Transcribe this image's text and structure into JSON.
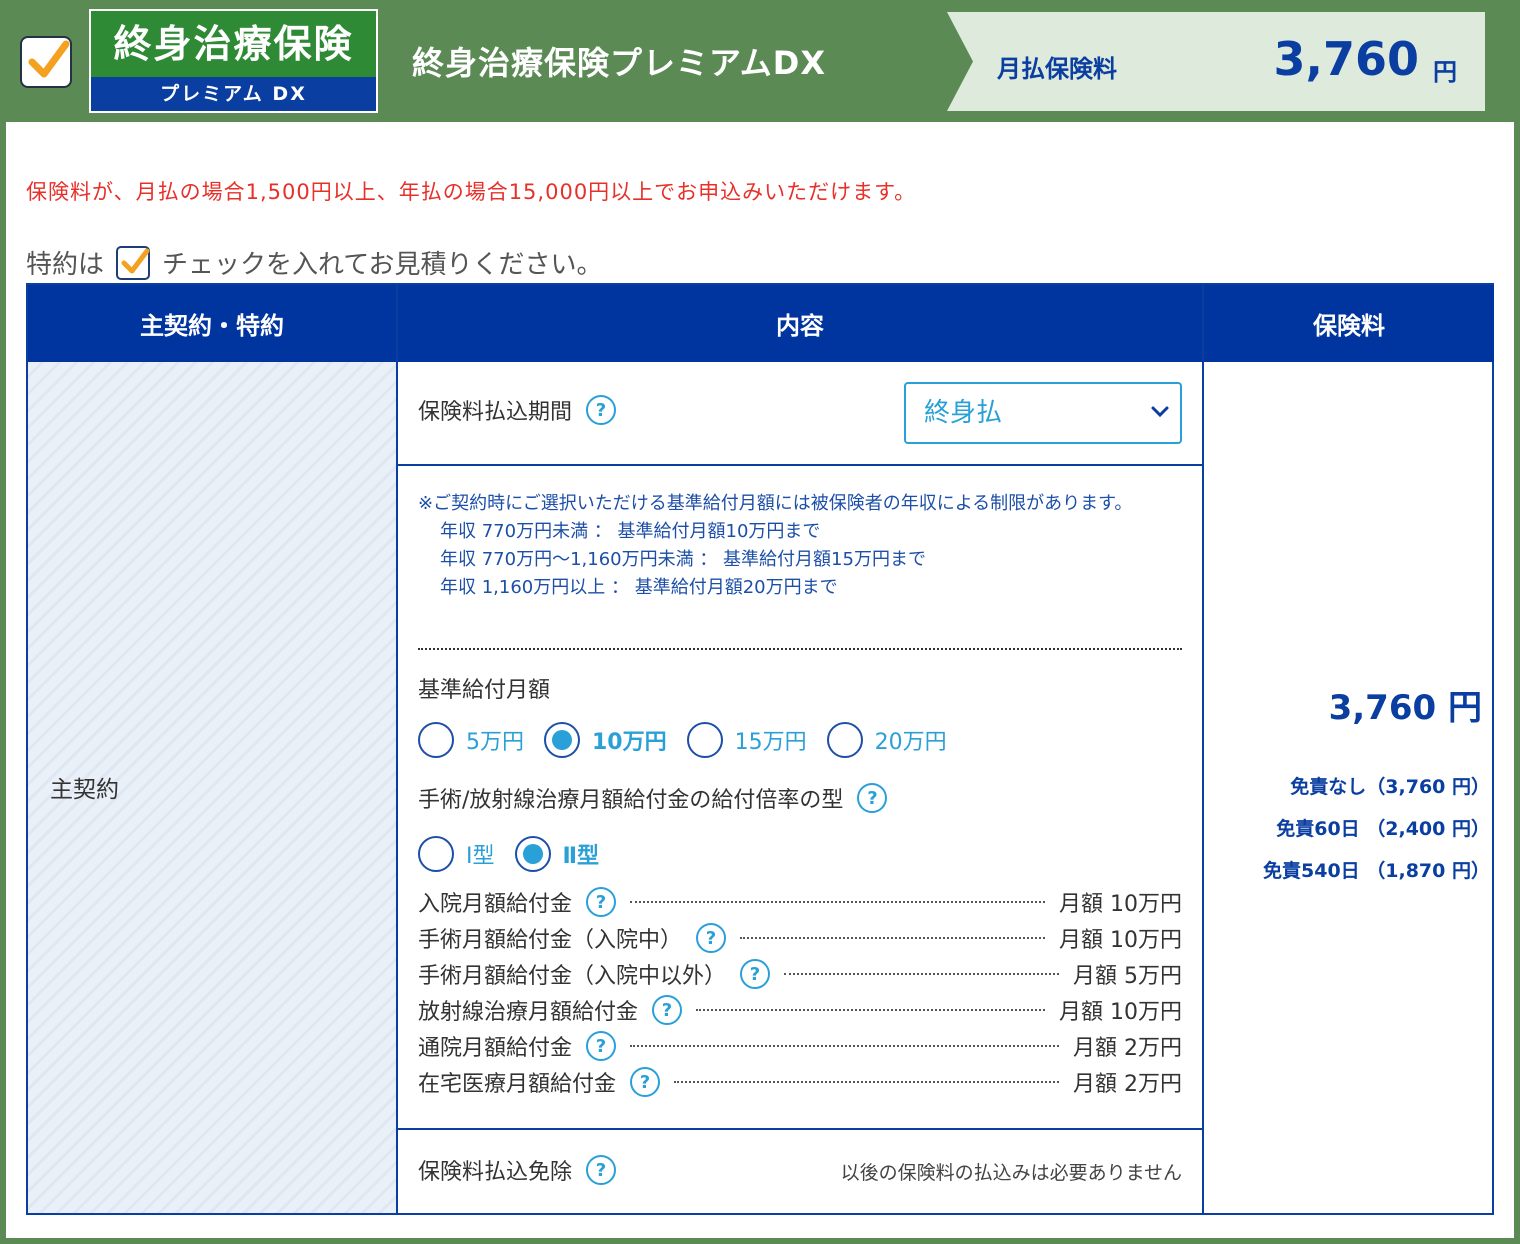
{
  "header": {
    "logo_top": "終身治療保険",
    "logo_bottom": "プレミアム DX",
    "title": "終身治療保険プレミアムDX",
    "premium_label": "月払保険料",
    "premium_value": "3,760",
    "premium_unit": "円"
  },
  "notice": "保険料が、月払の場合1,500円以上、年払の場合15,000円以上でお申込みいただけます。",
  "rider_note": {
    "before": "特約は",
    "after": "チェックを入れてお見積りください。"
  },
  "table": {
    "headers": [
      "主契約・特約",
      "内容",
      "保険料"
    ],
    "main_label": "主契約",
    "payment_period": {
      "label": "保険料払込期間",
      "selected": "終身払"
    },
    "info": {
      "line1": "※ご契約時にご選択いただける基準給付月額には被保険者の年収による制限があります。",
      "line2": "年収 770万円未満 ： 基準給付月額10万円まで",
      "line3": "年収 770万円～1,160万円未満 ： 基準給付月額15万円まで",
      "line4": "年収 1,160万円以上 ： 基準給付月額20万円まで"
    },
    "base_amount": {
      "label": "基準給付月額",
      "options": [
        "5万円",
        "10万円",
        "15万円",
        "20万円"
      ],
      "selected_index": 1
    },
    "multiplier": {
      "label": "手術/放射線治療月額給付金の給付倍率の型",
      "options": [
        "Ⅰ型",
        "Ⅱ型"
      ],
      "selected_index": 1
    },
    "benefits": [
      {
        "label": "入院月額給付金",
        "value": "月額 10万円"
      },
      {
        "label": "手術月額給付金（入院中）",
        "value": "月額 10万円"
      },
      {
        "label": "手術月額給付金（入院中以外）",
        "value": "月額 5万円"
      },
      {
        "label": "放射線治療月額給付金",
        "value": "月額 10万円"
      },
      {
        "label": "通院月額給付金",
        "value": "月額 2万円"
      },
      {
        "label": "在宅医療月額給付金",
        "value": "月額 2万円"
      }
    ],
    "waiver": {
      "label": "保険料払込免除",
      "text": "以後の保険料の払込みは必要ありません"
    },
    "price": {
      "main": "3,760 円",
      "deductibles": [
        "免責なし（3,760 円）",
        "免責60日 （2,400 円）",
        "免責540日 （1,870 円）"
      ]
    }
  },
  "icons": {
    "help": "?"
  },
  "colors": {
    "brand_green": "#5b8a55",
    "navy": "#0035a0",
    "accent_blue": "#2aa0d8",
    "alert_red": "#e8302a"
  }
}
